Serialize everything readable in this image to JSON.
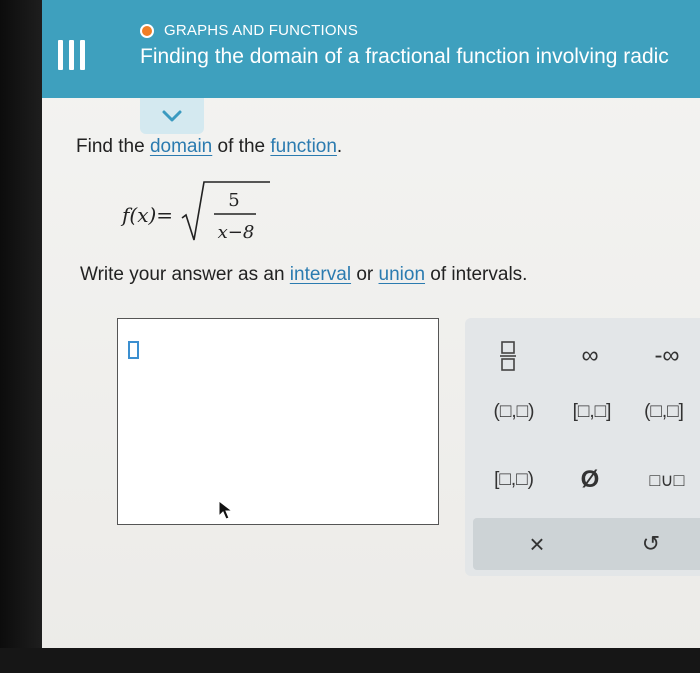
{
  "header": {
    "topic": "GRAPHS AND FUNCTIONS",
    "title": "Finding the domain of a fractional function involving radic",
    "colors": {
      "bar": "#3ea0be",
      "topic_dot": "#f07e26"
    }
  },
  "question": {
    "prompt_find": "Find the",
    "link_domain": "domain",
    "prompt_of": "of the",
    "link_function": "function",
    "prompt_period": ".",
    "formula": {
      "lhs": "f(x)=",
      "numerator": "5",
      "denominator": "x−8"
    },
    "instruction_start": "Write your answer as an",
    "link_interval": "interval",
    "instruction_or": "or",
    "link_union": "union",
    "instruction_end": "of intervals."
  },
  "keypad": {
    "keys": {
      "infinity": "∞",
      "neg_infinity": "-∞",
      "open_open": "(□,□)",
      "closed_closed": "[□,□]",
      "open_closed": "(□,□]",
      "closed_open": "[□,□)",
      "empty_set": "Ø",
      "union": "□∪□",
      "clear": "×",
      "undo": "↺"
    },
    "icons": [
      "fraction-icon",
      "clear-icon",
      "undo-icon"
    ]
  },
  "icons": [
    "menu-icon",
    "chevron-down-icon",
    "mouse-pointer-icon"
  ]
}
